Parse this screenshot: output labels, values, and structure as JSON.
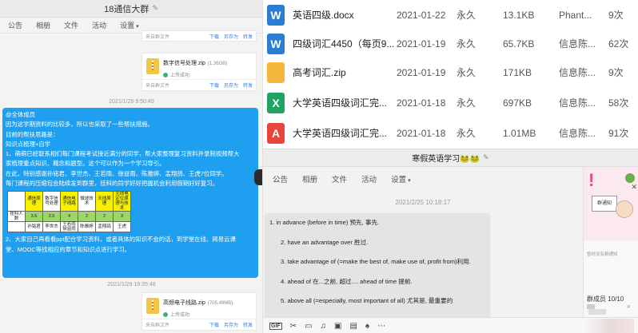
{
  "left_window": {
    "title": "18通信大群",
    "tabs": [
      "公告",
      "相册",
      "文件",
      "活动",
      "设置"
    ],
    "top_partial_file": {
      "source": "来自群文件",
      "actions": [
        "下载",
        "另存为",
        "转发"
      ]
    },
    "file1": {
      "name": "数字信号处理.zip",
      "size": "(1.36GB)",
      "status": "上传成功",
      "source": "来自群文件",
      "actions": [
        "下载",
        "另存为",
        "转发"
      ]
    },
    "timestamp1": "2021/1/29 9:50:49",
    "announcement": {
      "lines": [
        "@全体成员",
        "因为这学期资料的比较多，所以也采取了一些帮扶措施。",
        "目前的帮扶思路是：",
        "知识点梳理+自学",
        "1、萌萌已经联系相们每门课程考试接近满分的同学，帮大家整理复习资料并录制视频帮大",
        "家梳理重点知识、概念和题型。这个可以作为一个学习导引。",
        "在此，特别感谢孙铭君、李世杰、王若雨、徐益雨、陈雅婷、孟翔鸽、王虎7位同学。",
        "每门课程的压缩包会陆续发到群里，挂科的同学好好把握机会利用假期好好复习。"
      ],
      "table": {
        "header": [
          "",
          "通信原理",
          "数字信号处理",
          "通信电子线路",
          "微波技术",
          "天线原理",
          "无线电定位原理与技术"
        ],
        "rows": [
          [
            "挂科人数",
            "3.5",
            "3.5",
            "4",
            "2",
            "2",
            "3"
          ],
          [
            "",
            "孙铭君",
            "李世杰",
            "王若雨 徐益雨",
            "陈雅婷",
            "孟翔鸽",
            "王虎"
          ]
        ]
      },
      "tail_lines": [
        "2、大家自己再看看ppt配合学习资料，或者具体的知识不会的话，到学堂在线、网易云课",
        "堂、MOOC等找相应的章节和知识点进行学习。"
      ]
    },
    "timestamp2": "2021/1/29 19:35:48",
    "file2": {
      "name": "高频电子线路.zip",
      "size": "(705.49MB)",
      "status": "上传成功",
      "source": "来自群文件",
      "actions": [
        "下载",
        "另存为",
        "转发"
      ]
    }
  },
  "file_list": [
    {
      "icon": "W",
      "color": "#2b7cd3",
      "name": "英语四级.docx",
      "date": "2021-01-22",
      "expire": "永久",
      "size": "13.1KB",
      "uploader": "Phant...",
      "downloads": "9次"
    },
    {
      "icon": "W",
      "color": "#2b7cd3",
      "name": "四级词汇4450（每页9...",
      "date": "2021-01-19",
      "expire": "永久",
      "size": "65.7KB",
      "uploader": "信息陈...",
      "downloads": "62次"
    },
    {
      "icon": "",
      "color": "#f5b83d",
      "name": "高考词汇.zip",
      "date": "2021-01-19",
      "expire": "永久",
      "size": "171KB",
      "uploader": "信息陈...",
      "downloads": "9次"
    },
    {
      "icon": "X",
      "color": "#1fa463",
      "name": "大学英语四级词汇完...",
      "date": "2021-01-18",
      "expire": "永久",
      "size": "697KB",
      "uploader": "信息陈...",
      "downloads": "58次"
    },
    {
      "icon": "A",
      "color": "#e8453c",
      "name": "大学英语四级词汇完...",
      "date": "2021-01-18",
      "expire": "永久",
      "size": "1.01MB",
      "uploader": "信息陈...",
      "downloads": "91次"
    }
  ],
  "chat2": {
    "title": "寒假英语学习🐸🐸",
    "tabs": [
      "公告",
      "相册",
      "文件",
      "活动",
      "设置"
    ],
    "timestamp": "2021/2/25 10:18:17",
    "message_lines": [
      "1. in advance (before in time) 预先, 事先.",
      "2. have an advantage over 胜过.",
      "3. take advantage of (=make the best of, make use of, profit from)利用.",
      "4. ahead of 在...之前, 超过.... ahead of time 提前.",
      "5. above all (=especially, most important of all) 尤其是, 最重要的"
    ],
    "side": {
      "notice_label": "群通知",
      "tip": "暂时没有群通知",
      "members": "群成员 10/10"
    },
    "toolbar_gif": "GIF"
  }
}
